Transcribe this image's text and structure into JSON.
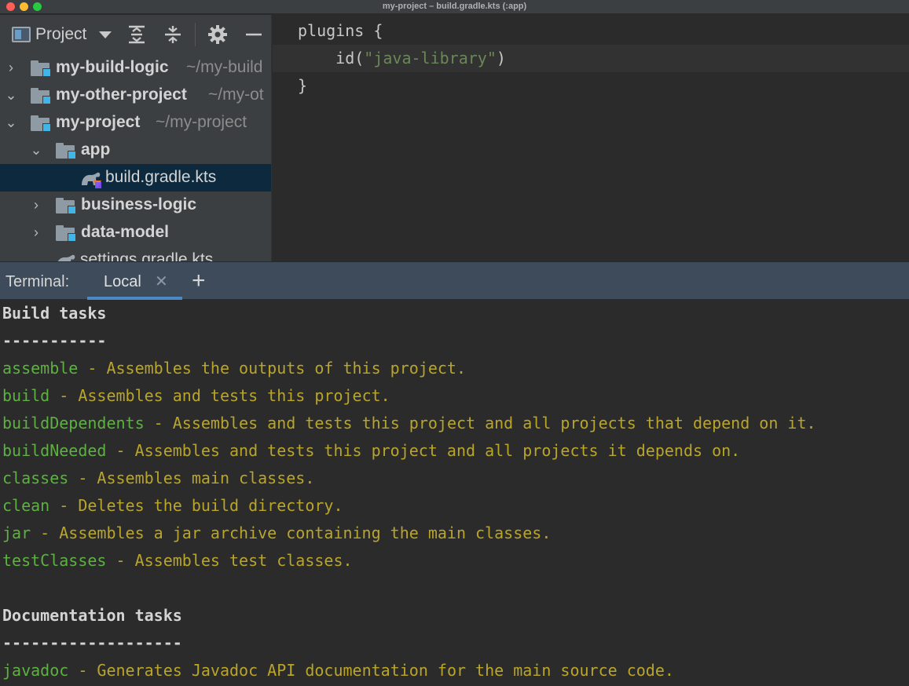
{
  "window": {
    "title": "my-project – build.gradle.kts (:app)"
  },
  "project_panel": {
    "title": "Project",
    "toolbar_icons": [
      "expand-all-icon",
      "collapse-all-icon",
      "gear-icon",
      "minimize-icon"
    ],
    "tree": [
      {
        "name": "my-build-logic",
        "path": "~/my-build",
        "expanded": false,
        "type": "module"
      },
      {
        "name": "my-other-project",
        "path": "~/my-ot",
        "expanded": true,
        "type": "module"
      },
      {
        "name": "my-project",
        "path": "~/my-project",
        "expanded": true,
        "type": "module"
      },
      {
        "name": "app",
        "path": "",
        "expanded": true,
        "type": "module"
      },
      {
        "name": "build.gradle.kts",
        "path": "",
        "type": "gradle-file",
        "selected": true
      },
      {
        "name": "business-logic",
        "path": "",
        "expanded": false,
        "type": "module"
      },
      {
        "name": "data-model",
        "path": "",
        "expanded": false,
        "type": "module"
      },
      {
        "name": "settings.gradle.kts",
        "path": "",
        "type": "gradle-file"
      }
    ]
  },
  "editor": {
    "lines": [
      {
        "text": "plugins {"
      },
      {
        "prefix": "    id(",
        "string": "\"java-library\"",
        "suffix": ")"
      },
      {
        "text": "}"
      }
    ]
  },
  "terminal": {
    "label": "Terminal:",
    "tab_label": "Local",
    "close_glyph": "✕",
    "add_glyph": "+",
    "lines": [
      {
        "kind": "heading",
        "text": "Build tasks"
      },
      {
        "kind": "heading",
        "text": "-----------"
      },
      {
        "kind": "task",
        "task": "assemble",
        "desc": " - Assembles the outputs of this project."
      },
      {
        "kind": "task",
        "task": "build",
        "desc": " - Assembles and tests this project."
      },
      {
        "kind": "task",
        "task": "buildDependents",
        "desc": " - Assembles and tests this project and all projects that depend on it."
      },
      {
        "kind": "task",
        "task": "buildNeeded",
        "desc": " - Assembles and tests this project and all projects it depends on."
      },
      {
        "kind": "task",
        "task": "classes",
        "desc": " - Assembles main classes."
      },
      {
        "kind": "task",
        "task": "clean",
        "desc": " - Deletes the build directory."
      },
      {
        "kind": "task",
        "task": "jar",
        "desc": " - Assembles a jar archive containing the main classes."
      },
      {
        "kind": "task",
        "task": "testClasses",
        "desc": " - Assembles test classes."
      },
      {
        "kind": "blank",
        "text": ""
      },
      {
        "kind": "heading",
        "text": "Documentation tasks"
      },
      {
        "kind": "heading",
        "text": "-------------------"
      },
      {
        "kind": "task",
        "task": "javadoc",
        "desc": " - Generates Javadoc API documentation for the main source code."
      }
    ]
  },
  "colors": {
    "task_name": "#5db141",
    "task_desc": "#b9a52a",
    "string_literal": "#6a8759",
    "selection": "#0d293e",
    "terminal_header": "#3d4b5a",
    "tab_underline": "#4a88c7"
  }
}
